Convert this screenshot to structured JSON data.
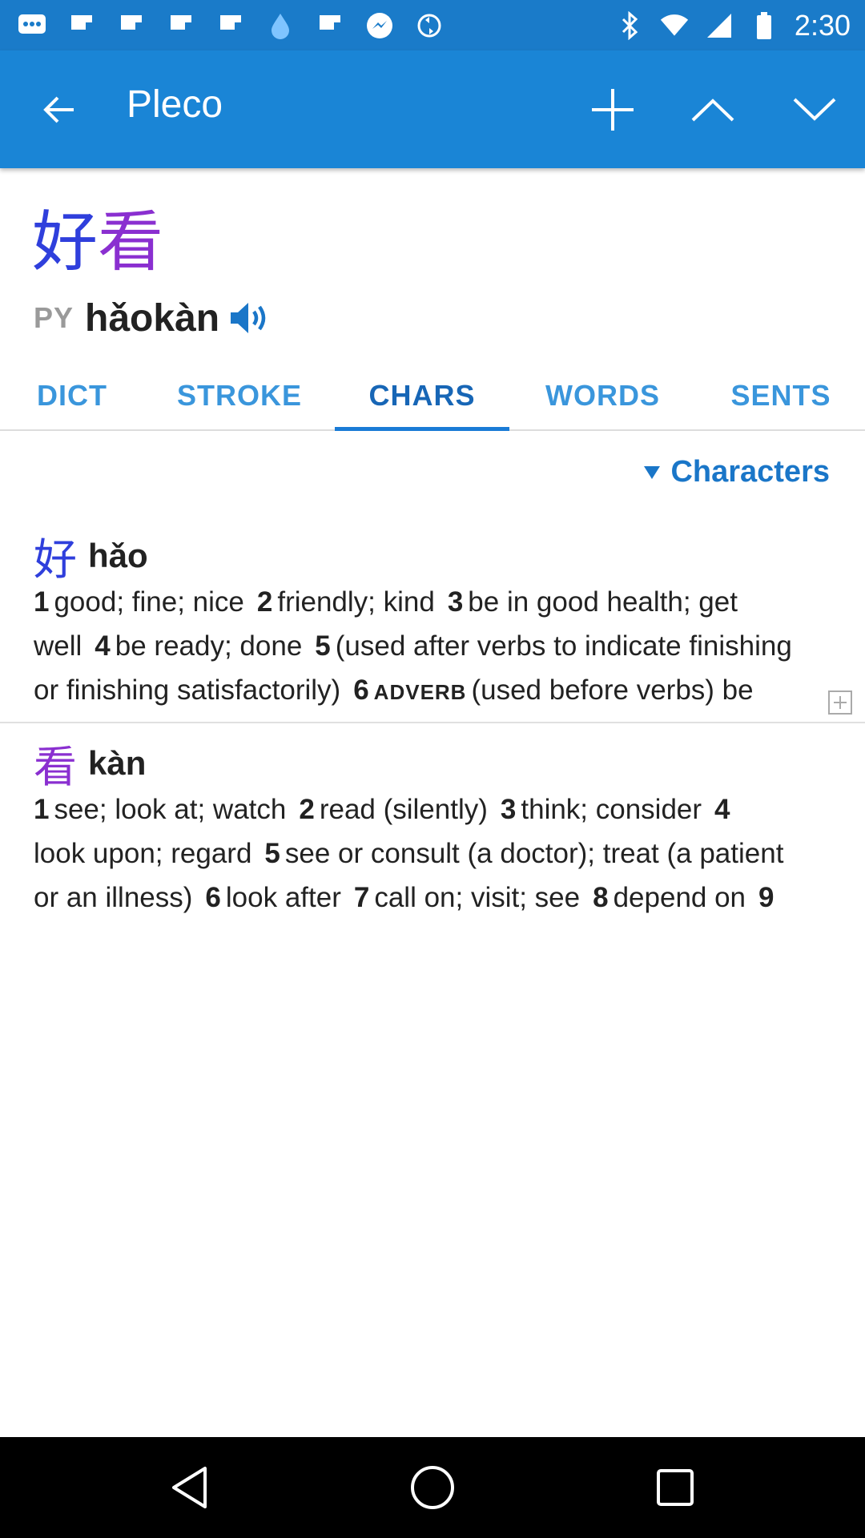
{
  "status_bar": {
    "time": "2:30",
    "left_icons": [
      "message-icon",
      "flipboard-icon",
      "flipboard-icon",
      "flipboard-icon",
      "flipboard-icon",
      "water-drop-icon",
      "flipboard-icon",
      "messenger-icon",
      "sync-icon"
    ],
    "right_icons": [
      "bluetooth-icon",
      "wifi-icon",
      "signal-icon",
      "battery-icon"
    ]
  },
  "app_bar": {
    "title": "Pleco",
    "buttons": [
      "back-arrow-icon",
      "add-icon",
      "chevron-up-icon",
      "chevron-down-icon"
    ],
    "color": "#1a85d6"
  },
  "headword": {
    "chars": [
      "好",
      "看"
    ],
    "pinyin_label": "PY",
    "pinyin": "hǎokàn"
  },
  "tabs": [
    {
      "label": "DICT",
      "active": false
    },
    {
      "label": "STROKE",
      "active": false
    },
    {
      "label": "CHARS",
      "active": true
    },
    {
      "label": "WORDS",
      "active": false
    },
    {
      "label": "SENTS",
      "active": false
    }
  ],
  "section": {
    "title": "Characters"
  },
  "entries": [
    {
      "char": "好",
      "pinyin": "hǎo",
      "lines": [
        [
          {
            "n": "1",
            "t": "good; fine; nice"
          },
          {
            "n": "2",
            "t": "friendly; kind"
          },
          {
            "n": "3",
            "t": "be in good health; get"
          }
        ],
        [
          {
            "n": "",
            "t": "well"
          },
          {
            "n": "4",
            "t": "be ready; done"
          },
          {
            "n": "5",
            "t": "(used after verbs to indicate finishing"
          }
        ],
        [
          {
            "n": "",
            "t": "or finishing satisfactorily)"
          },
          {
            "n": "6",
            "pos": "ADVERB",
            "t": "(used before verbs) be"
          }
        ]
      ]
    },
    {
      "char": "看",
      "pinyin": "kàn",
      "lines": [
        [
          {
            "n": "1",
            "t": "see; look at; watch"
          },
          {
            "n": "2",
            "t": "read (silently)"
          },
          {
            "n": "3",
            "t": "think; consider"
          },
          {
            "n": "4",
            "t": ""
          }
        ],
        [
          {
            "n": "",
            "t": "look upon; regard"
          },
          {
            "n": "5",
            "t": "see or consult (a doctor); treat (a patient"
          }
        ],
        [
          {
            "n": "",
            "t": "or an illness)"
          },
          {
            "n": "6",
            "t": "look after"
          },
          {
            "n": "7",
            "t": "call on; visit; see"
          },
          {
            "n": "8",
            "t": "depend on"
          },
          {
            "n": "9",
            "t": ""
          }
        ]
      ]
    }
  ],
  "nav_bar": {
    "buttons": [
      "back-triangle-icon",
      "home-circle-icon",
      "recents-square-icon"
    ]
  },
  "colors": {
    "status_bar": "#1a7bc9",
    "accent": "#1a76c8",
    "char_1": "#2f3fdc",
    "char_2": "#8a2fd0"
  }
}
